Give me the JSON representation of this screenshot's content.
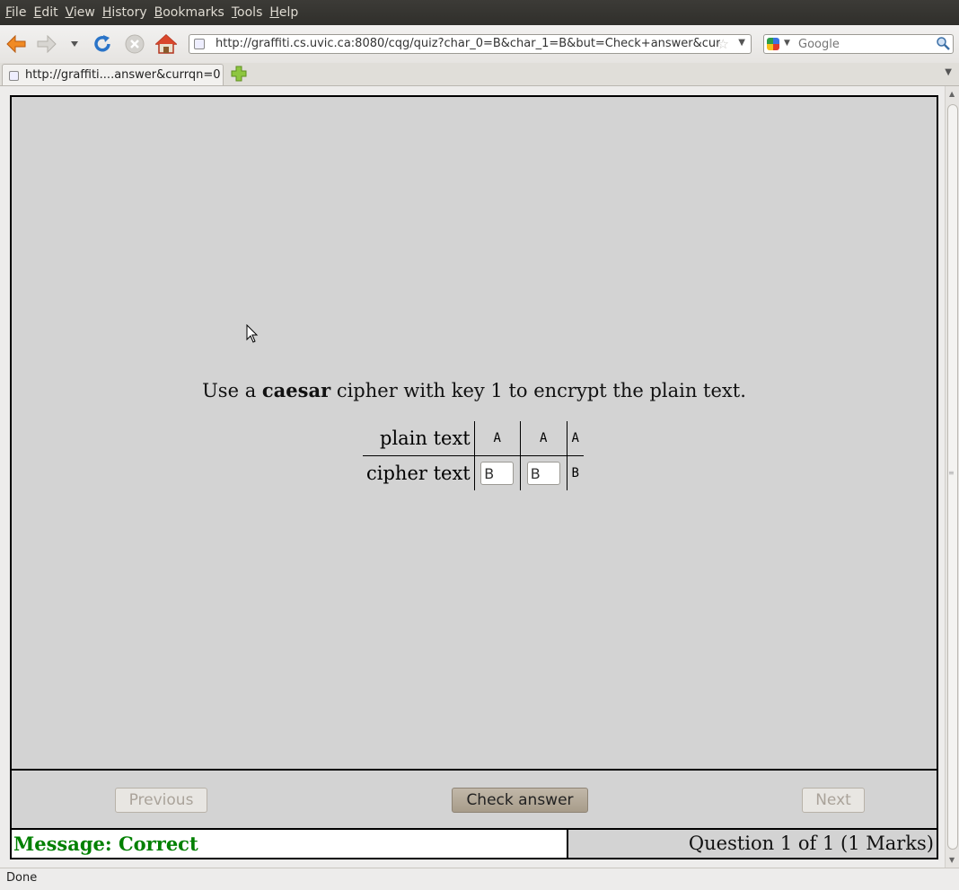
{
  "browser": {
    "menu": [
      "File",
      "Edit",
      "View",
      "History",
      "Bookmarks",
      "Tools",
      "Help"
    ],
    "url": "http://graffiti.cs.uvic.ca:8080/cqg/quiz?char_0=B&char_1=B&but=Check+answer&currqn=0",
    "search_placeholder": "Google",
    "tab_title": "http://graffiti....answer&currqn=0",
    "status": "Done"
  },
  "quiz": {
    "prompt_before": "Use a ",
    "cipher_name": "caesar",
    "prompt_after": " cipher with key 1 to encrypt the plain text.",
    "plain_label": "plain text",
    "cipher_label": "cipher text",
    "plain_chars": [
      "A",
      "A",
      "A"
    ],
    "cipher_inputs": [
      "B",
      "B"
    ],
    "cipher_given": "B",
    "buttons": {
      "previous": "Previous",
      "check": "Check answer",
      "next": "Next"
    },
    "message": "Message: Correct",
    "progress": "Question 1 of 1 (1 Marks)"
  },
  "colors": {
    "message_correct": "#008000",
    "panel_bg": "#d3d3d3"
  }
}
